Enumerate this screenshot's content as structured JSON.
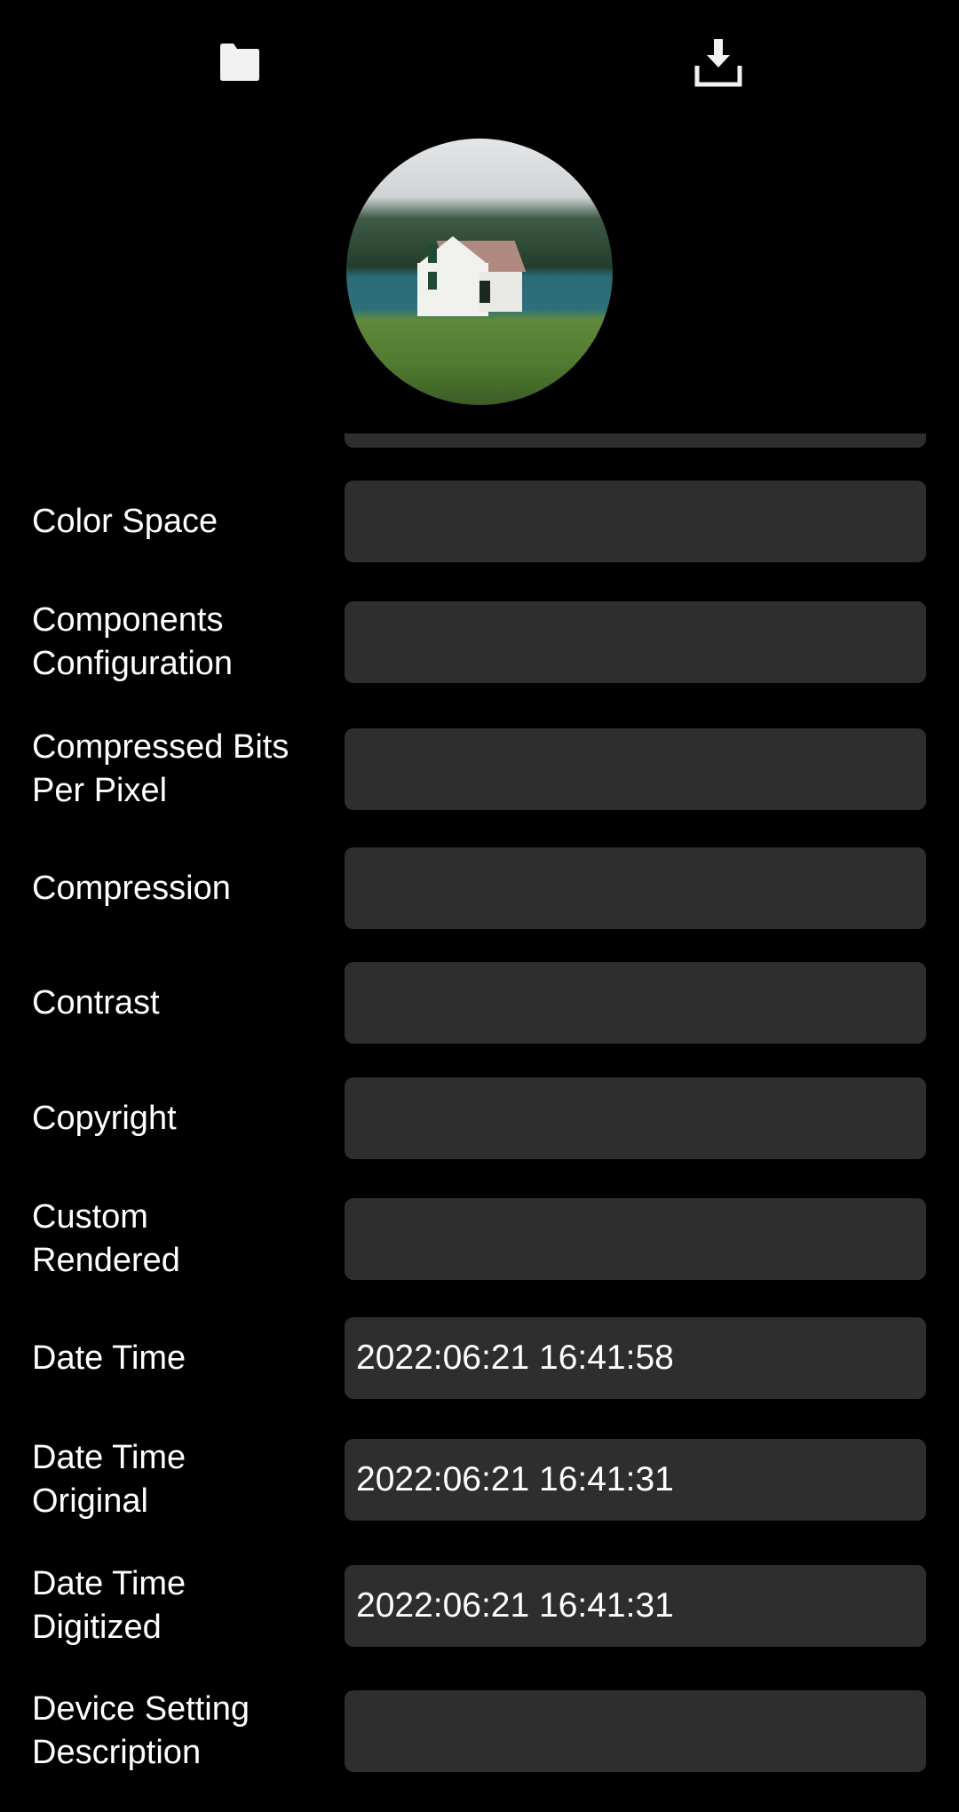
{
  "toolbar": {
    "folder_icon": "folder-icon",
    "download_icon": "download-icon"
  },
  "preview": {
    "alt": "house by lake"
  },
  "fields": [
    {
      "label": "Color Space",
      "value": ""
    },
    {
      "label": "Components Configuration",
      "value": ""
    },
    {
      "label": "Compressed Bits Per Pixel",
      "value": ""
    },
    {
      "label": "Compression",
      "value": ""
    },
    {
      "label": "Contrast",
      "value": ""
    },
    {
      "label": "Copyright",
      "value": ""
    },
    {
      "label": "Custom Rendered",
      "value": ""
    },
    {
      "label": "Date Time",
      "value": "2022:06:21 16:41:58"
    },
    {
      "label": "Date Time Original",
      "value": "2022:06:21 16:41:31"
    },
    {
      "label": "Date Time Digitized",
      "value": "2022:06:21 16:41:31"
    },
    {
      "label": "Device Setting Description",
      "value": ""
    }
  ]
}
